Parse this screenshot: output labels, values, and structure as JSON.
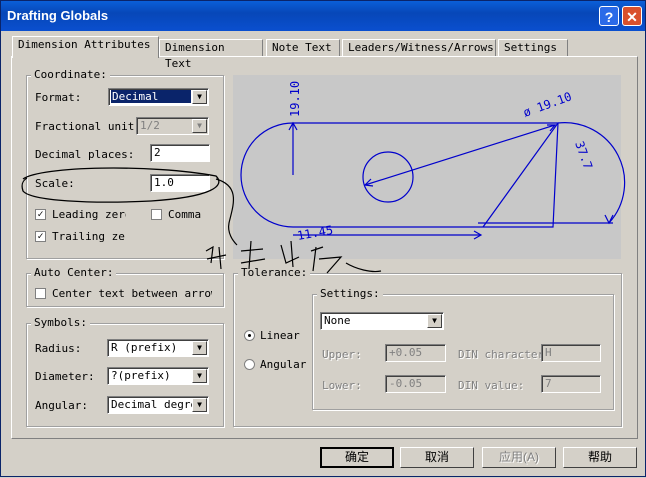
{
  "window": {
    "title": "Drafting Globals",
    "help_label": "?",
    "close_label": "✕"
  },
  "tabs": [
    {
      "label": "Dimension Attributes",
      "active": true
    },
    {
      "label": "Dimension Text"
    },
    {
      "label": "Note Text"
    },
    {
      "label": "Leaders/Witness/Arrows"
    },
    {
      "label": "Settings"
    }
  ],
  "coordinate": {
    "title": "Coordinate:",
    "format_label": "Format:",
    "format_value": "Decimal",
    "fractional_label": "Fractional unit:",
    "fractional_value": "1/2",
    "decimal_places_label": "Decimal places:",
    "decimal_places_value": "2",
    "scale_label": "Scale:",
    "scale_value": "1.0",
    "leading_zero_label": "Leading zero",
    "leading_zero_checked": true,
    "comma_label": "Comma",
    "comma_checked": false,
    "trailing_zero_label": "Trailing zero",
    "trailing_zero_checked": true
  },
  "auto_center": {
    "title": "Auto Center:",
    "center_text_label": "Center text between arrowh",
    "checked": false
  },
  "symbols": {
    "title": "Symbols:",
    "radius_label": "Radius:",
    "radius_value": "R (prefix)",
    "diameter_label": "Diameter:",
    "diameter_value": "?(prefix)",
    "angular_label": "Angular:",
    "angular_value": "Decimal degree"
  },
  "preview": {
    "dim_vertical": "19.10",
    "dim_diameter": "ø 19.10",
    "dim_angle": "37.7",
    "dim_horizontal": "11.45"
  },
  "tolerance": {
    "title": "Tolerance:",
    "linear_label": "Linear",
    "angular_label": "Angular",
    "selected": "Linear",
    "settings_title": "Settings:",
    "settings_value": "None",
    "upper_label": "Upper:",
    "upper_value": "+0.05",
    "lower_label": "Lower:",
    "lower_value": "-0.05",
    "din_character_label": "DIN character",
    "din_character_value": "H",
    "din_value_label": "DIN value:",
    "din_value_value": "7"
  },
  "buttons": {
    "ok": "确定",
    "cancel": "取消",
    "apply": "应用(A)",
    "help": "帮助"
  },
  "annotation": {
    "handwritten_note": "显示比例"
  },
  "colors": {
    "titlebar": "#0a4fcf",
    "dialog_bg": "#d4d0c8",
    "preview_bg": "#c8c8c8",
    "dimension_lines": "#0000cc"
  }
}
